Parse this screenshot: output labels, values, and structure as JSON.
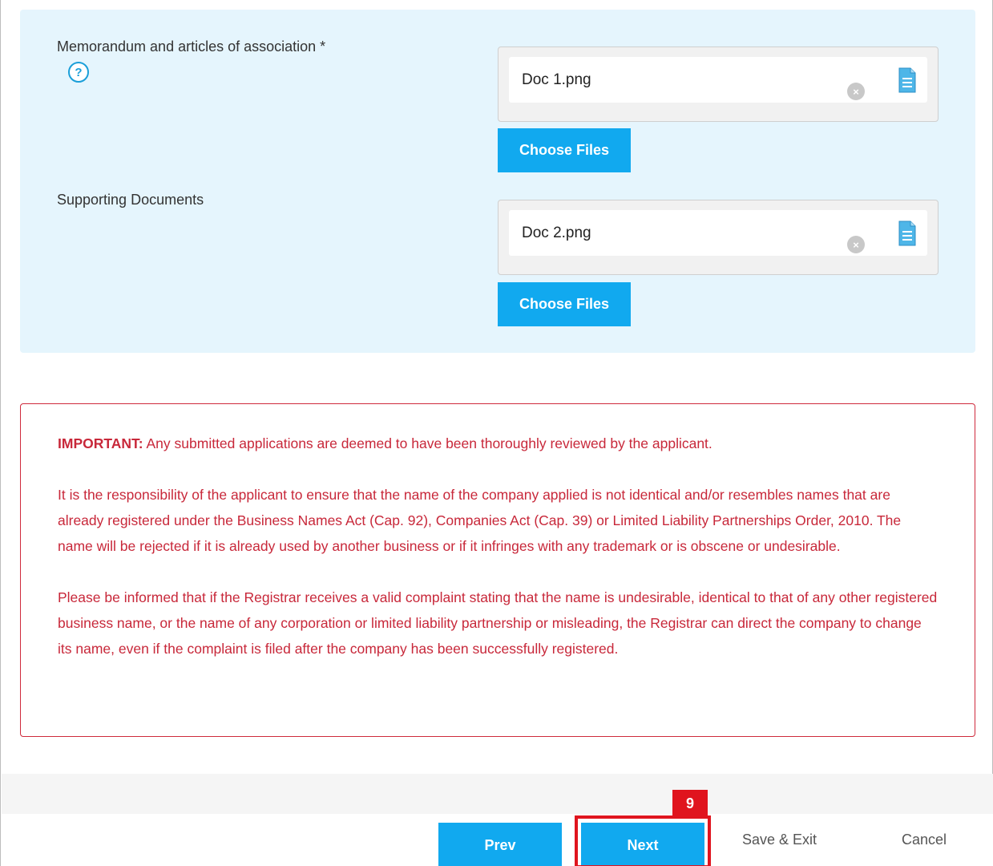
{
  "upload_panel": {
    "fields": [
      {
        "label": "Memorandum and articles of association *",
        "help_icon": "?",
        "file_name": "Doc 1.png",
        "choose_label": "Choose Files"
      },
      {
        "label": "Supporting Documents",
        "file_name": "Doc 2.png",
        "choose_label": "Choose Files"
      }
    ],
    "remove_glyph": "×"
  },
  "notice": {
    "important_label": "IMPORTANT:",
    "important_text": " Any submitted applications are deemed to have been thoroughly reviewed by the applicant.",
    "paragraph_2": "It is the responsibility of the applicant to ensure that the name of the company applied is not identical and/or resembles names that are already registered under the Business Names Act (Cap. 92), Companies Act (Cap. 39) or Limited Liability Partnerships Order, 2010. The name will be rejected if it is already used by another business or if it infringes with any trademark or is obscene or undesirable.",
    "paragraph_3": "Please be informed that if the Registrar receives a valid complaint stating that the name is undesirable, identical to that of any other registered business name, or the name of any corporation or limited liability partnership or misleading, the Registrar can direct the company to change its name, even if the complaint is filed after the company has been successfully registered."
  },
  "footer": {
    "prev_label": "Prev",
    "next_label": "Next",
    "save_exit_label": "Save & Exit",
    "cancel_label": "Cancel"
  },
  "annotation": {
    "step_number": "9"
  },
  "colors": {
    "primary_button": "#11a9ef",
    "panel_bg": "#e5f5fd",
    "notice_red": "#c8283a",
    "highlight_red": "#e0141e"
  },
  "icons": {
    "help": "question-circle-icon",
    "remove": "close-circle-icon",
    "file": "document-icon"
  }
}
